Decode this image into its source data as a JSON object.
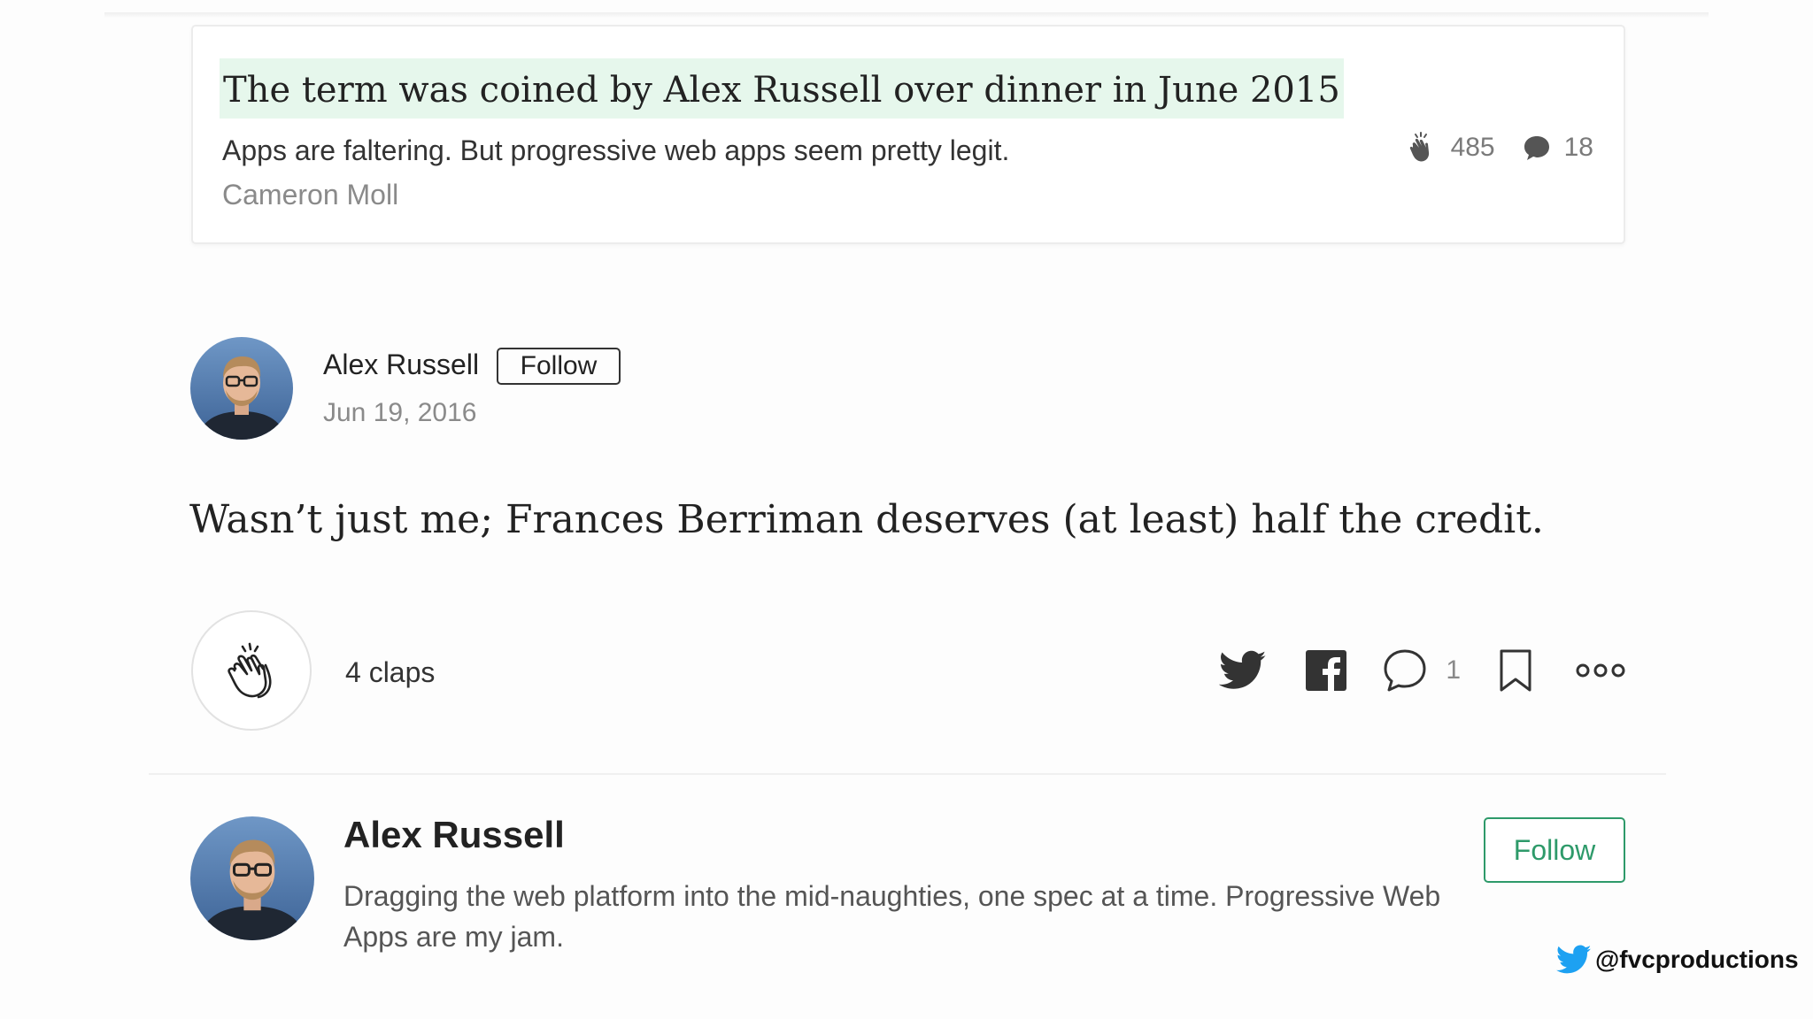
{
  "quote_card": {
    "title": "The term was coined by Alex Russell over dinner in June 2015",
    "subtitle": "Apps are faltering. But progressive web apps seem pretty legit.",
    "author": "Cameron Moll",
    "claps": "485",
    "responses": "18",
    "highlight_color": "#e6f7ec"
  },
  "response": {
    "author_name": "Alex Russell",
    "follow_label": "Follow",
    "date": "Jun 19, 2016",
    "body": "Wasn’t just me; Frances Berriman deserves (at least) half the credit."
  },
  "actions": {
    "claps_label": "4 claps",
    "comment_count": "1",
    "icons": [
      "clap-icon",
      "twitter-icon",
      "facebook-icon",
      "comment-icon",
      "bookmark-icon",
      "more-icon"
    ]
  },
  "author_bio": {
    "name": "Alex Russell",
    "description": "Dragging the web platform into the mid-naughties, one spec at a time. Progressive Web Apps are my jam.",
    "follow_label": "Follow",
    "accent_color": "#2e9a6a"
  },
  "watermark": {
    "handle": "@fvcproductions",
    "color": "#1da1f2"
  }
}
